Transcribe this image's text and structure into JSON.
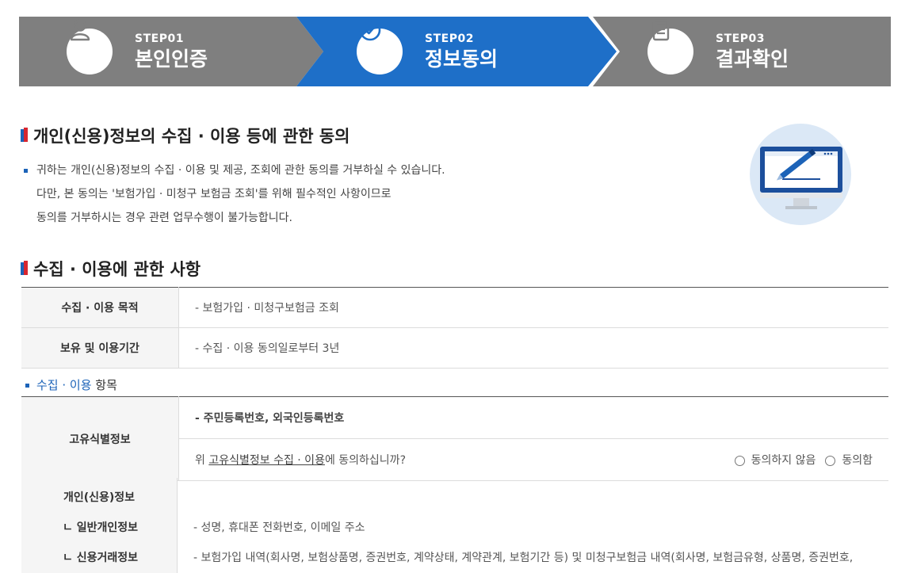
{
  "steps": [
    {
      "label": "STEP01",
      "name": "본인인증",
      "icon": "person-icon",
      "active": false
    },
    {
      "label": "STEP02",
      "name": "정보동의",
      "icon": "check-circle-icon",
      "active": true
    },
    {
      "label": "STEP03",
      "name": "결과확인",
      "icon": "document-icon",
      "active": false
    }
  ],
  "colors": {
    "step_inactive": "#7f7f7f",
    "step_active": "#1e6fc8",
    "accent_blue": "#1c63b8"
  },
  "section1": {
    "title": "개인(신용)정보의 수집 · 이용 등에 관한 동의",
    "lines": [
      "귀하는 개인(신용)정보의 수집 · 이용 및 제공, 조회에 관한 동의를 거부하실 수 있습니다.",
      "다만, 본 동의는 '보험가입 · 미청구 보험금 조회'를 위해 필수적인 사항이므로",
      "동의를 거부하시는 경우 관련 업무수행이 불가능합니다."
    ]
  },
  "section2": {
    "title": "수집 · 이용에 관한 사항",
    "rows": [
      {
        "th": "수집 · 이용 목적",
        "td": "- 보험가입 · 미청구보험금 조회"
      },
      {
        "th": "보유 및 이용기간",
        "td": "- 수집 · 이용 동의일로부터 3년"
      }
    ]
  },
  "items": {
    "sub_blue": "수집 · 이용",
    "sub_rest": " 항목",
    "unique": {
      "th": "고유식별정보",
      "value": "- 주민등록번호, 외국인등록번호",
      "q_pre": "위 ",
      "q_link": "고유식별정보 수집 · 이용",
      "q_post": "에 동의하십니까?",
      "disagree": "동의하지 않음",
      "agree": "동의함"
    },
    "personal": {
      "th": "개인(신용)정보",
      "general_th": "ㄴ 일반개인정보",
      "general_td": "- 성명, 휴대폰 전화번호, 이메일 주소",
      "credit_th": "ㄴ 신용거래정보",
      "credit_td": "- 보험가입 내역(회사명, 보험상품명, 증권번호, 계약상태, 계약관계, 보험기간 등) 및 미청구보험금 내역(회사명, 보험금유형, 상품명, 증권번호,"
    }
  }
}
